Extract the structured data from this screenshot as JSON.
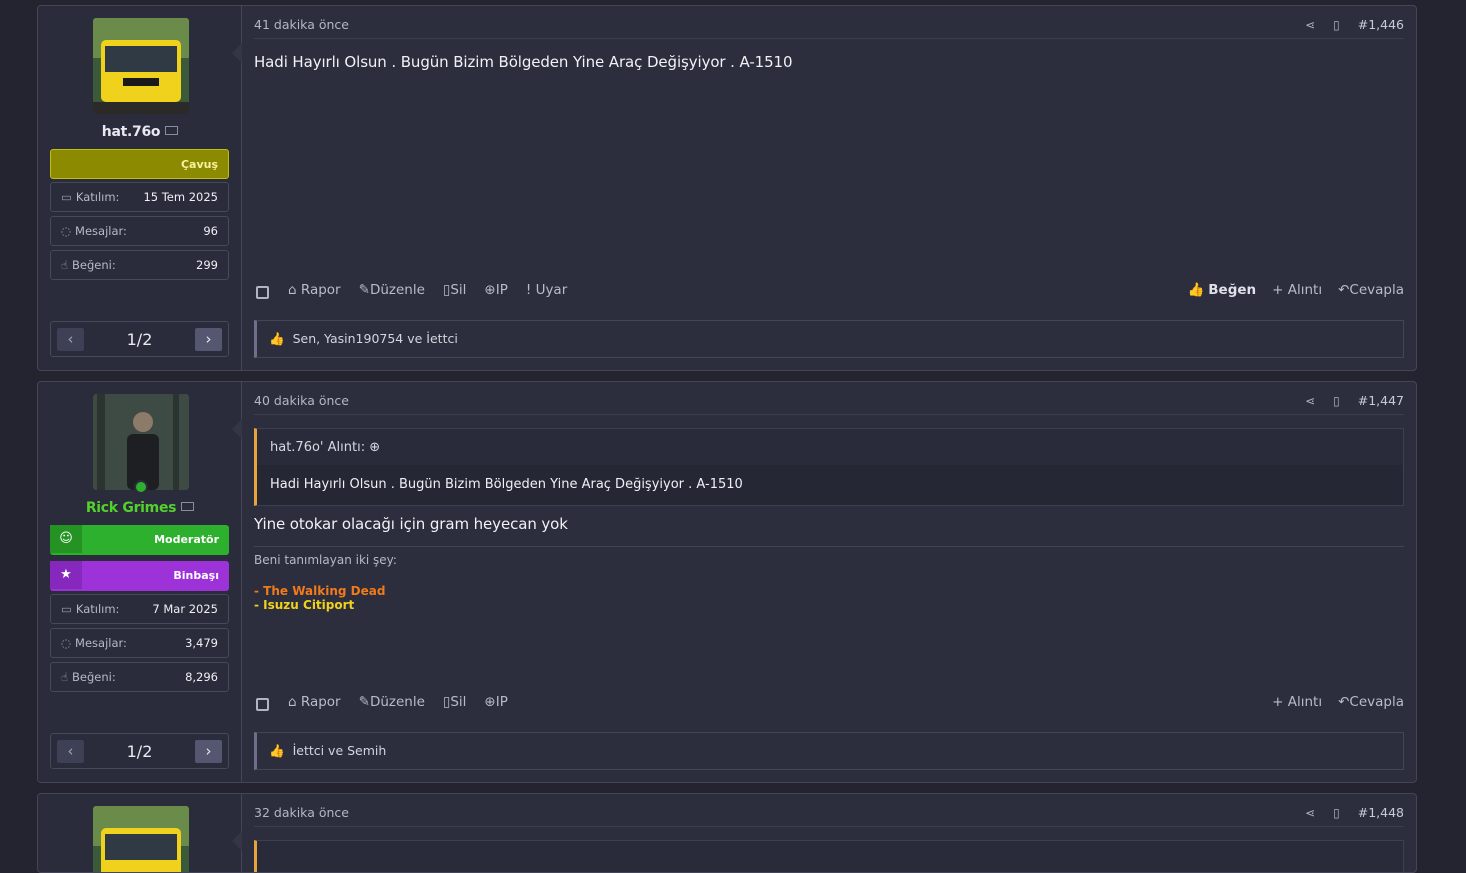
{
  "posts": [
    {
      "username": "hat.76o",
      "banners": [
        {
          "label": "Çavuş",
          "color": "#8b8a00"
        }
      ],
      "stats": {
        "joined_label": "Katılım:",
        "joined": "15 Tem 2025",
        "messages_label": "Mesajlar:",
        "messages": "96",
        "likes_label": "Beğeni:",
        "likes": "299"
      },
      "pager": "1/2",
      "time": "41 dakika önce",
      "number": "#1,446",
      "text": "Hadi Hayırlı Olsun . Bugün Bizim Bölgeden Yine Araç Değişyiyor . A-1510",
      "actions_left": [
        "Rapor",
        "Düzenle",
        "Sil",
        "IP",
        "Uyar"
      ],
      "actions_right": [
        "Beğen",
        "Alıntı",
        "Cevapla"
      ],
      "likes_text": "Sen, Yasin190754 ve İettci"
    },
    {
      "username": "Rick Grimes",
      "username_color": "#53d12c",
      "banners": [
        {
          "label": "Moderatör",
          "color": "#2db02d"
        },
        {
          "label": "Binbaşı",
          "color": "#9d32d8"
        }
      ],
      "stats": {
        "joined_label": "Katılım:",
        "joined": "7 Mar 2025",
        "messages_label": "Mesajlar:",
        "messages": "3,479",
        "likes_label": "Beğeni:",
        "likes": "8,296"
      },
      "pager": "1/2",
      "time": "40 dakika önce",
      "number": "#1,447",
      "quote_header": "hat.76o' Alıntı:",
      "quote_body": "Hadi Hayırlı Olsun . Bugün Bizim Bölgeden Yine Araç Değişyiyor . A-1510",
      "text": "Yine otokar olacağı için gram heyecan yok",
      "signature": {
        "intro": "Beni tanımlayan iki şey:",
        "line1": "- The Walking Dead",
        "line2": "- Isuzu Citiport"
      },
      "actions_left": [
        "Rapor",
        "Düzenle",
        "Sil",
        "IP"
      ],
      "actions_right": [
        "Alıntı",
        "Cevapla"
      ],
      "likes_text": "İettci ve Semih"
    },
    {
      "time": "32 dakika önce",
      "number": "#1,448"
    }
  ]
}
